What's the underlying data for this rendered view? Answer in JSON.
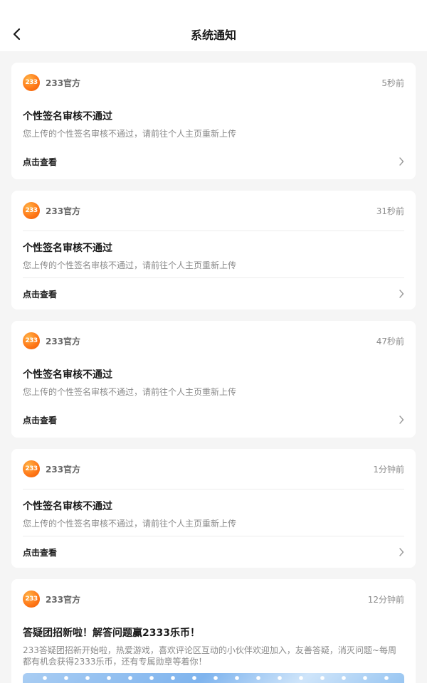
{
  "header": {
    "title": "系统通知"
  },
  "notifications": [
    {
      "source": "233官方",
      "logo_text": "233",
      "time": "5秒前",
      "title": "个性签名审核不通过",
      "desc": "您上传的个性签名审核不通过，请前往个人主页重新上传",
      "action": "点击查看"
    },
    {
      "source": "233官方",
      "logo_text": "233",
      "time": "31秒前",
      "title": "个性签名审核不通过",
      "desc": "您上传的个性签名审核不通过，请前往个人主页重新上传",
      "action": "点击查看"
    },
    {
      "source": "233官方",
      "logo_text": "233",
      "time": "47秒前",
      "title": "个性签名审核不通过",
      "desc": "您上传的个性签名审核不通过，请前往个人主页重新上传",
      "action": "点击查看"
    },
    {
      "source": "233官方",
      "logo_text": "233",
      "time": "1分钟前",
      "title": "个性签名审核不通过",
      "desc": "您上传的个性签名审核不通过，请前往个人主页重新上传",
      "action": "点击查看"
    },
    {
      "source": "233官方",
      "logo_text": "233",
      "time": "12分钟前",
      "title": "答疑团招新啦！解答问题赢2333乐币！",
      "desc": "233答疑团招新开始啦，热爱游戏，喜欢评论区互动的小伙伴欢迎加入，友善答疑，消灭问题~每周都有机会获得2333乐币，还有专属勋章等着你！"
    }
  ],
  "colors": {
    "brand_orange": "#ff7a1a",
    "background": "#f5f5f5",
    "banner_blue": "#7fb4ee"
  },
  "icons": {
    "back": "chevron-left-icon",
    "more": "chevron-right-icon"
  }
}
